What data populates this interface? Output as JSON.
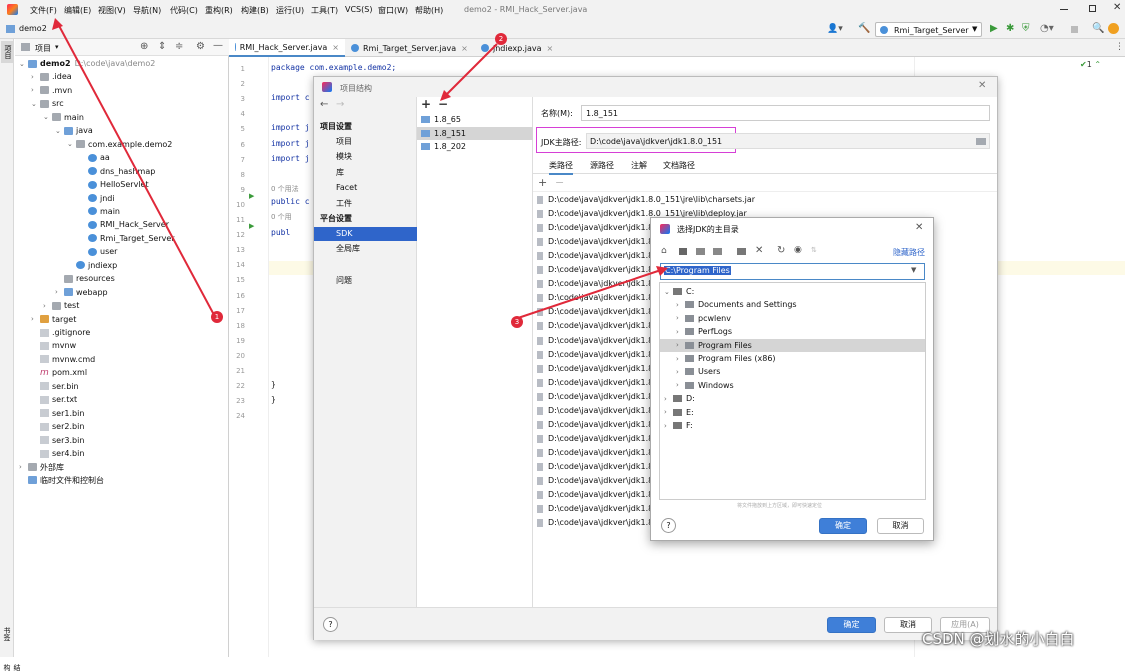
{
  "menubar": {
    "items": [
      "文件(F)",
      "编辑(E)",
      "视图(V)",
      "导航(N)",
      "代码(C)",
      "重构(R)",
      "构建(B)",
      "运行(U)",
      "工具(T)",
      "VCS(S)",
      "窗口(W)",
      "帮助(H)"
    ],
    "window_title": "demo2 - RMI_Hack_Server.java"
  },
  "navbar": {
    "breadcrumb": "demo2",
    "run_config": "Rmi_Target_Server"
  },
  "project": {
    "header": "项目",
    "tree": [
      {
        "label": "demo2",
        "hint": "D:\\code\\java\\demo2",
        "indent": 0,
        "icon": "folder-blue",
        "arrow": "v",
        "bold": true
      },
      {
        "label": ".idea",
        "indent": 1,
        "icon": "folder",
        "arrow": ">"
      },
      {
        "label": ".mvn",
        "indent": 1,
        "icon": "folder",
        "arrow": ">"
      },
      {
        "label": "src",
        "indent": 1,
        "icon": "folder",
        "arrow": "v"
      },
      {
        "label": "main",
        "indent": 2,
        "icon": "folder",
        "arrow": "v"
      },
      {
        "label": "java",
        "indent": 3,
        "icon": "folder-blue",
        "arrow": "v"
      },
      {
        "label": "com.example.demo2",
        "indent": 4,
        "icon": "folder",
        "arrow": "v"
      },
      {
        "label": "aa",
        "indent": 5,
        "icon": "class",
        "arrow": ""
      },
      {
        "label": "dns_hashmap",
        "indent": 5,
        "icon": "class",
        "arrow": ""
      },
      {
        "label": "HelloServlet",
        "indent": 5,
        "icon": "class",
        "arrow": ""
      },
      {
        "label": "jndi",
        "indent": 5,
        "icon": "class",
        "arrow": ""
      },
      {
        "label": "main",
        "indent": 5,
        "icon": "class",
        "arrow": ""
      },
      {
        "label": "RMI_Hack_Server",
        "indent": 5,
        "icon": "class",
        "arrow": ""
      },
      {
        "label": "Rmi_Target_Server",
        "indent": 5,
        "icon": "class",
        "arrow": ""
      },
      {
        "label": "user",
        "indent": 5,
        "icon": "class",
        "arrow": ""
      },
      {
        "label": "jndiexp",
        "indent": 4,
        "icon": "class",
        "arrow": ""
      },
      {
        "label": "resources",
        "indent": 3,
        "icon": "folder",
        "arrow": ""
      },
      {
        "label": "webapp",
        "indent": 3,
        "icon": "folder-blue",
        "arrow": ">"
      },
      {
        "label": "test",
        "indent": 2,
        "icon": "folder",
        "arrow": ">"
      },
      {
        "label": "target",
        "indent": 1,
        "icon": "folder-orange",
        "arrow": ">"
      },
      {
        "label": ".gitignore",
        "indent": 1,
        "icon": "file",
        "arrow": ""
      },
      {
        "label": "mvnw",
        "indent": 1,
        "icon": "file",
        "arrow": ""
      },
      {
        "label": "mvnw.cmd",
        "indent": 1,
        "icon": "file",
        "arrow": ""
      },
      {
        "label": "pom.xml",
        "indent": 1,
        "icon": "maven",
        "arrow": ""
      },
      {
        "label": "ser.bin",
        "indent": 1,
        "icon": "file",
        "arrow": ""
      },
      {
        "label": "ser.txt",
        "indent": 1,
        "icon": "file",
        "arrow": ""
      },
      {
        "label": "ser1.bin",
        "indent": 1,
        "icon": "file",
        "arrow": ""
      },
      {
        "label": "ser2.bin",
        "indent": 1,
        "icon": "file",
        "arrow": ""
      },
      {
        "label": "ser3.bin",
        "indent": 1,
        "icon": "file",
        "arrow": ""
      },
      {
        "label": "ser4.bin",
        "indent": 1,
        "icon": "file",
        "arrow": ""
      },
      {
        "label": "外部库",
        "indent": 0,
        "icon": "library",
        "arrow": ">"
      },
      {
        "label": "临时文件和控制台",
        "indent": 0,
        "icon": "scratch",
        "arrow": ""
      }
    ]
  },
  "leftstrip": {
    "top": "项目",
    "bottom1": "书签",
    "bottom2": "结构"
  },
  "editor": {
    "tabs": [
      "RMI_Hack_Server.java",
      "Rmi_Target_Server.java",
      "jndiexp.java"
    ],
    "lines": [
      "1",
      "2",
      "3",
      "4",
      "5",
      "6",
      "7",
      "8",
      "9",
      "10",
      "11",
      "12",
      "13",
      "14",
      "15",
      "16",
      "17",
      "18",
      "19",
      "20",
      "21",
      "22",
      "23",
      "24"
    ],
    "code": [
      {
        "line": 1,
        "text": "package com.example.demo2;"
      },
      {
        "line": 3,
        "text": "import c"
      },
      {
        "line": 5,
        "text": "import j"
      },
      {
        "line": 6,
        "text": "import j"
      },
      {
        "line": 7,
        "text": "import j"
      },
      {
        "line": 9,
        "text": "0 个用法",
        "hint": true
      },
      {
        "line": 9.9,
        "text": "public c"
      },
      {
        "line": 10.9,
        "text": "    0 个用",
        "hint": true
      },
      {
        "line": 11.9,
        "text": "    publ"
      },
      {
        "line": 22,
        "text": "    }"
      },
      {
        "line": 23,
        "text": "}"
      }
    ],
    "inspection": "1"
  },
  "project_structure": {
    "title": "项目结构",
    "nav": {
      "project_settings_header": "项目设置",
      "project_settings": [
        "项目",
        "模块",
        "库",
        "Facet",
        "工件"
      ],
      "platform_settings_header": "平台设置",
      "platform_settings": [
        "SDK",
        "全局库"
      ],
      "problems": "问题"
    },
    "sdk_list": [
      "1.8_65",
      "1.8_151",
      "1.8_202"
    ],
    "selected_sdk": "1.8_151",
    "name_label": "名称(M):",
    "name_value": "1.8_151",
    "jdk_home_label": "JDK主路径:",
    "jdk_home_value": "D:\\code\\java\\jdkver\\jdk1.8.0_151",
    "detail_tabs": [
      "类路径",
      "源路径",
      "注解",
      "文档路径"
    ],
    "classpath": [
      "D:\\code\\java\\jdkver\\jdk1.8.0_151\\jre\\lib\\charsets.jar",
      "D:\\code\\java\\jdkver\\jdk1.8.0_151\\jre\\lib\\deploy.jar",
      "D:\\code\\java\\jdkver\\jdk1.8",
      "D:\\code\\java\\jdkver\\jdk1.8",
      "D:\\code\\java\\jdkver\\jdk1.8",
      "D:\\code\\java\\jdkver\\jdk1.8",
      "D:\\code\\java\\jdkver\\jdk1.8",
      "D:\\code\\java\\jdkver\\jdk1.8",
      "D:\\code\\java\\jdkver\\jdk1.8",
      "D:\\code\\java\\jdkver\\jdk1.8",
      "D:\\code\\java\\jdkver\\jdk1.8",
      "D:\\code\\java\\jdkver\\jdk1.8",
      "D:\\code\\java\\jdkver\\jdk1.8",
      "D:\\code\\java\\jdkver\\jdk1.8",
      "D:\\code\\java\\jdkver\\jdk1.8",
      "D:\\code\\java\\jdkver\\jdk1.8",
      "D:\\code\\java\\jdkver\\jdk1.8",
      "D:\\code\\java\\jdkver\\jdk1.8",
      "D:\\code\\java\\jdkver\\jdk1.8",
      "D:\\code\\java\\jdkver\\jdk1.8",
      "D:\\code\\java\\jdkver\\jdk1.8",
      "D:\\code\\java\\jdkver\\jdk1.8",
      "D:\\code\\java\\jdkver\\jdk1.8",
      "D:\\code\\java\\jdkver\\jdk1.8"
    ],
    "ok": "确定",
    "cancel": "取消",
    "apply": "应用(A)",
    "help": "?"
  },
  "jdk_chooser": {
    "title": "选择JDK的主目录",
    "hide_path": "隐藏路径",
    "path_value": "C:\\Program Files",
    "tree": [
      {
        "label": "C:",
        "indent": 0,
        "arrow": "v"
      },
      {
        "label": "Documents and Settings",
        "indent": 1,
        "arrow": ">"
      },
      {
        "label": "pcwlenv",
        "indent": 1,
        "arrow": ">"
      },
      {
        "label": "PerfLogs",
        "indent": 1,
        "arrow": ">"
      },
      {
        "label": "Program Files",
        "indent": 1,
        "arrow": ">",
        "selected": true
      },
      {
        "label": "Program Files (x86)",
        "indent": 1,
        "arrow": ">"
      },
      {
        "label": "Users",
        "indent": 1,
        "arrow": ">"
      },
      {
        "label": "Windows",
        "indent": 1,
        "arrow": ">"
      },
      {
        "label": "D:",
        "indent": 0,
        "arrow": ">"
      },
      {
        "label": "E:",
        "indent": 0,
        "arrow": ">"
      },
      {
        "label": "F:",
        "indent": 0,
        "arrow": ">"
      }
    ],
    "drop_hint": "将文件拖放到上方区域，即可快速定位",
    "ok": "确定",
    "cancel": "取消",
    "help": "?"
  },
  "annotations": {
    "badge1": "1",
    "badge2": "2",
    "badge3": "3",
    "color": "#e0293a"
  },
  "watermark": "CSDN @划水的小白白",
  "colors": {
    "accent": "#3f7fd8",
    "selection": "#2f65ca",
    "highlight_box": "#d63fd6",
    "annotation": "#e0293a"
  }
}
